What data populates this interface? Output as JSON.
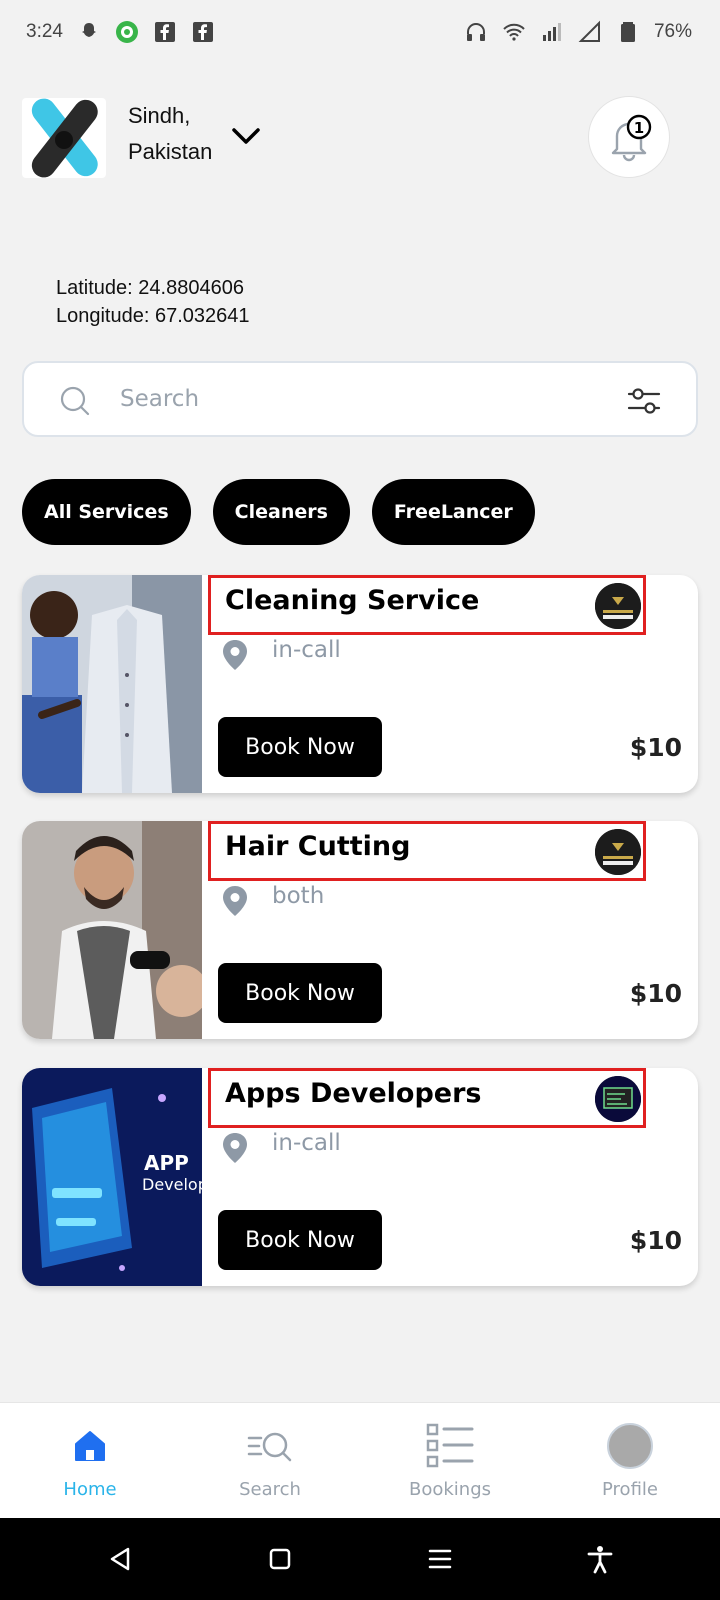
{
  "status_bar": {
    "time": "3:24",
    "battery": "76%"
  },
  "header": {
    "location_line1": "Sindh,",
    "location_line2": "Pakistan",
    "notification_count": "1"
  },
  "coordinates": {
    "latitude": "Latitude: 24.8804606",
    "longitude": "Longitude: 67.032641"
  },
  "search": {
    "placeholder": "Search",
    "value": ""
  },
  "chips": [
    "All Services",
    "Cleaners",
    "FreeLancer"
  ],
  "services": [
    {
      "title": "Cleaning Service",
      "location_type": "in-call",
      "button": "Book Now",
      "price": "$10"
    },
    {
      "title": "Hair Cutting",
      "location_type": "both",
      "button": "Book Now",
      "price": "$10"
    },
    {
      "title": "Apps Developers",
      "location_type": "in-call",
      "button": "Book Now",
      "price": "$10",
      "image_text_1": "APP",
      "image_text_2": "Develop"
    }
  ],
  "bottom_nav": [
    {
      "label": "Home",
      "icon": "home-icon",
      "active": true
    },
    {
      "label": "Search",
      "icon": "search-list-icon",
      "active": false
    },
    {
      "label": "Bookings",
      "icon": "list-icon",
      "active": false
    },
    {
      "label": "Profile",
      "icon": "avatar-icon",
      "active": false
    }
  ],
  "colors": {
    "accent": "#2bb4e9",
    "muted": "#9aa3ad",
    "highlight_border": "#e02020",
    "chip_bg": "#000000"
  }
}
